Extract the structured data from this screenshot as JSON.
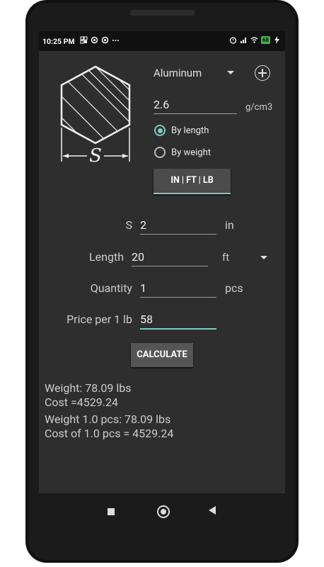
{
  "status": {
    "time": "10:25 PM",
    "battery": "68"
  },
  "header": {
    "material": "Aluminum",
    "density_value": "2.6",
    "density_unit": "g/cm3",
    "shape_label": "S"
  },
  "mode": {
    "by_length": "By length",
    "by_weight": "By weight",
    "selected": "by_length"
  },
  "unit_system_button": "IN | FT | LB",
  "form": {
    "s_label": "S",
    "s_value": "2",
    "s_unit": "in",
    "length_label": "Length",
    "length_value": "20",
    "length_unit": "ft",
    "quantity_label": "Quantity",
    "quantity_value": "1",
    "quantity_unit": "pcs",
    "price_label": "Price per 1 lb",
    "price_value": "58"
  },
  "calculate_button": "CALCULATE",
  "results": {
    "weight": "Weight:  78.09  lbs",
    "cost": "Cost =4529.24",
    "weight_pcs": "Weight 1.0  pcs: 78.09  lbs",
    "cost_pcs": "Cost of 1.0  pcs  = 4529.24"
  },
  "colors": {
    "accent": "#80cbc4",
    "background": "#2e2e2e"
  }
}
